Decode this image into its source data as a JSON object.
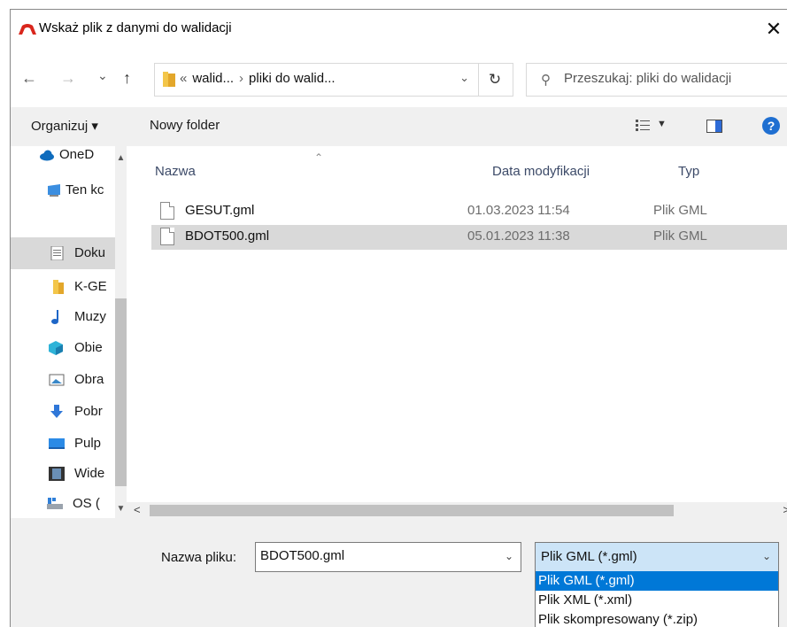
{
  "window": {
    "title": "Wskaż plik z danymi do walidacji",
    "close_glyph": "✕"
  },
  "nav": {
    "back": "←",
    "forward": "→",
    "recent": "⌄",
    "up": "↑",
    "address": {
      "overflow": "«",
      "part1": "walid...",
      "sep": "›",
      "part2": "pliki do walid..."
    },
    "refresh": "↻",
    "search_placeholder": "Przeszukaj: pliki do walidacji"
  },
  "toolbar": {
    "organize": "Organizuj ▾",
    "new_folder": "Nowy folder",
    "help": "?"
  },
  "sidebar": {
    "items": [
      {
        "label": "OneD",
        "icon": "onedrive-icon"
      },
      {
        "label": "Ten kc",
        "icon": "this-pc-icon"
      },
      {
        "label": "Doku",
        "icon": "documents-icon"
      },
      {
        "label": "K-GE",
        "icon": "folder-icon"
      },
      {
        "label": "Muzy",
        "icon": "music-icon"
      },
      {
        "label": "Obie",
        "icon": "3d-objects-icon"
      },
      {
        "label": "Obra",
        "icon": "pictures-icon"
      },
      {
        "label": "Pobr",
        "icon": "downloads-icon"
      },
      {
        "label": "Pulp",
        "icon": "desktop-icon"
      },
      {
        "label": "Wide",
        "icon": "videos-icon"
      },
      {
        "label": "OS (",
        "icon": "drive-icon"
      }
    ]
  },
  "files": {
    "columns": {
      "name": "Nazwa",
      "date": "Data modyfikacji",
      "type": "Typ"
    },
    "rows": [
      {
        "name": "GESUT.gml",
        "date": "01.03.2023 11:54",
        "type": "Plik GML"
      },
      {
        "name": "BDOT500.gml",
        "date": "05.01.2023 11:38",
        "type": "Plik GML"
      }
    ]
  },
  "bottom": {
    "filename_label": "Nazwa pliku:",
    "filename_value": "BDOT500.gml",
    "filetype_value": "Plik GML (*.gml)",
    "filetype_options": [
      "Plik GML (*.gml)",
      "Plik XML (*.xml)",
      "Plik skompresowany (*.zip)"
    ]
  },
  "colors": {
    "selection": "#d9d9d9",
    "dropdown_highlight": "#0078d7",
    "combo_focus": "#cce4f7"
  }
}
